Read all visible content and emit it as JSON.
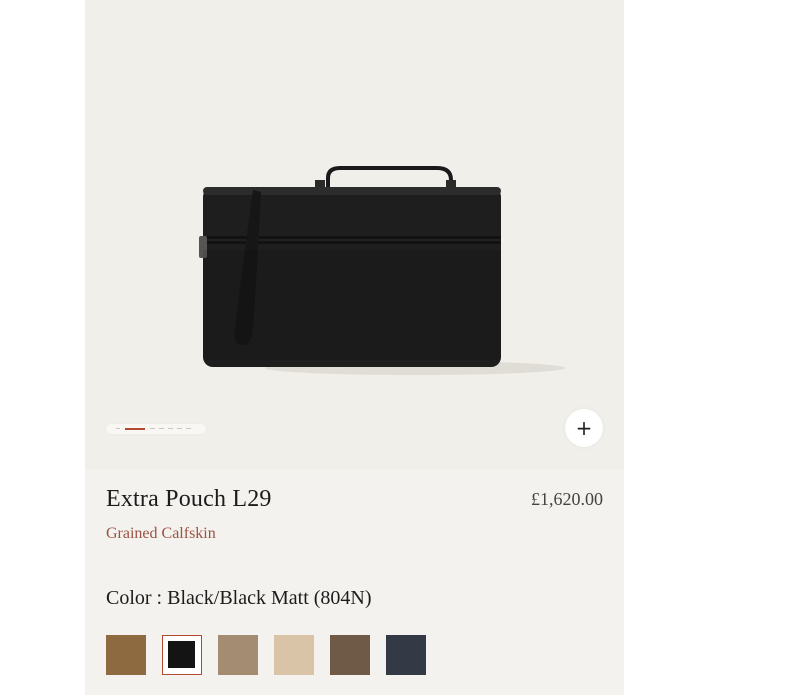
{
  "product": {
    "title": "Extra Pouch L29",
    "material": "Grained Calfskin",
    "price": "£1,620.00"
  },
  "gallery": {
    "image_count": 7,
    "active_index": 1,
    "zoom_icon": "plus-icon",
    "zoom_label": "+"
  },
  "color": {
    "label": "Color : Black/Black Matt (804N)",
    "selected_index": 1,
    "swatches": [
      {
        "name": "tan-brown",
        "hex": "#8d6a3f"
      },
      {
        "name": "black",
        "hex": "#141414"
      },
      {
        "name": "taupe",
        "hex": "#a48c72"
      },
      {
        "name": "beige",
        "hex": "#d9c4a8"
      },
      {
        "name": "dark-taupe",
        "hex": "#6f5a48"
      },
      {
        "name": "navy",
        "hex": "#343a45"
      }
    ]
  },
  "colors": {
    "panel_bg": "#f4f2ee",
    "accent": "#b34a2f",
    "material_text": "#9b5343"
  }
}
